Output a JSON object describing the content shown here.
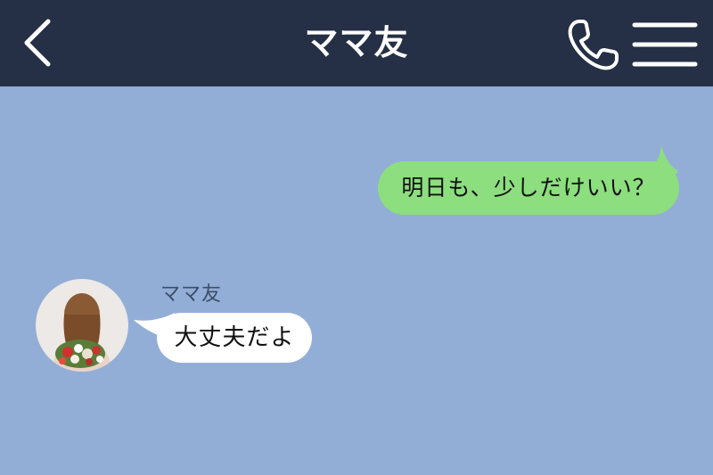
{
  "header": {
    "title": "ママ友",
    "back_icon": "chevron-left-icon",
    "call_icon": "phone-icon",
    "menu_icon": "hamburger-menu-icon"
  },
  "messages": [
    {
      "direction": "outgoing",
      "text": "明日も、少しだけいい？"
    },
    {
      "direction": "incoming",
      "sender": "ママ友",
      "text": "大丈夫だよ"
    }
  ],
  "colors": {
    "header_bg": "#252f45",
    "chat_bg": "#93aed6",
    "outgoing_bubble": "#8cde7e",
    "incoming_bubble": "#ffffff"
  }
}
